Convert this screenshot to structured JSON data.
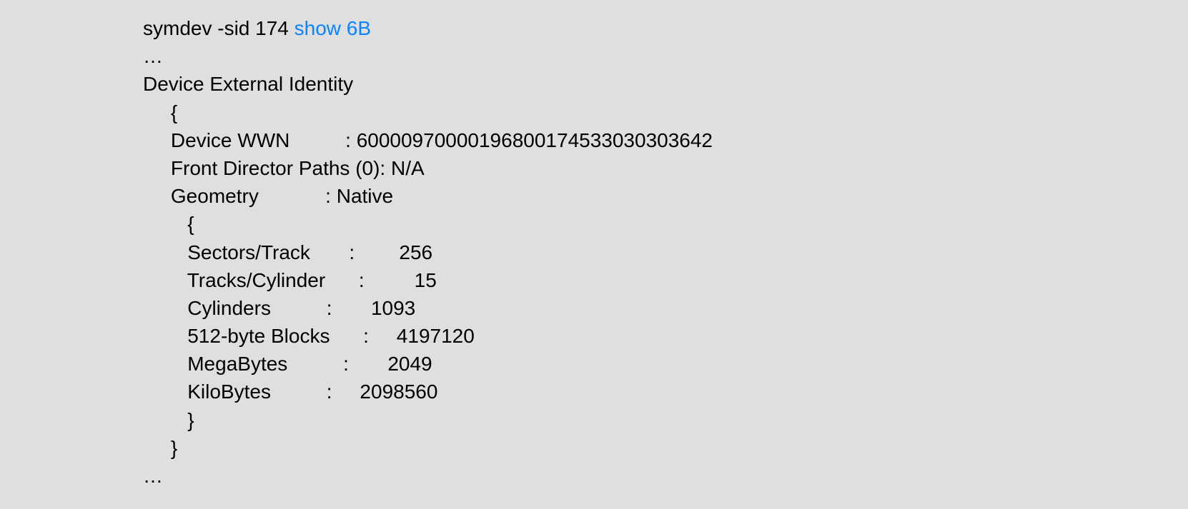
{
  "command": {
    "prefix": "symdev -sid 174 ",
    "highlight": "show 6B"
  },
  "lines": {
    "ell1": "…",
    "header": "Device External Identity",
    "brace1_open": "     {",
    "wwn": "     Device WWN          : 60000970000196800174533030303642",
    "fdp": "     Front Director Paths (0): N/A",
    "geom": "     Geometry            : Native",
    "brace2_open": "        {",
    "sectors": "        Sectors/Track       :        256",
    "tracks": "        Tracks/Cylinder      :         15",
    "cylinders": "        Cylinders          :       1093",
    "blocks": "        512-byte Blocks      :     4197120",
    "mb": "        MegaBytes          :       2049",
    "kb": "        KiloBytes          :     2098560",
    "brace2_close": "        }",
    "brace1_close": "     }",
    "ell2": "…"
  }
}
